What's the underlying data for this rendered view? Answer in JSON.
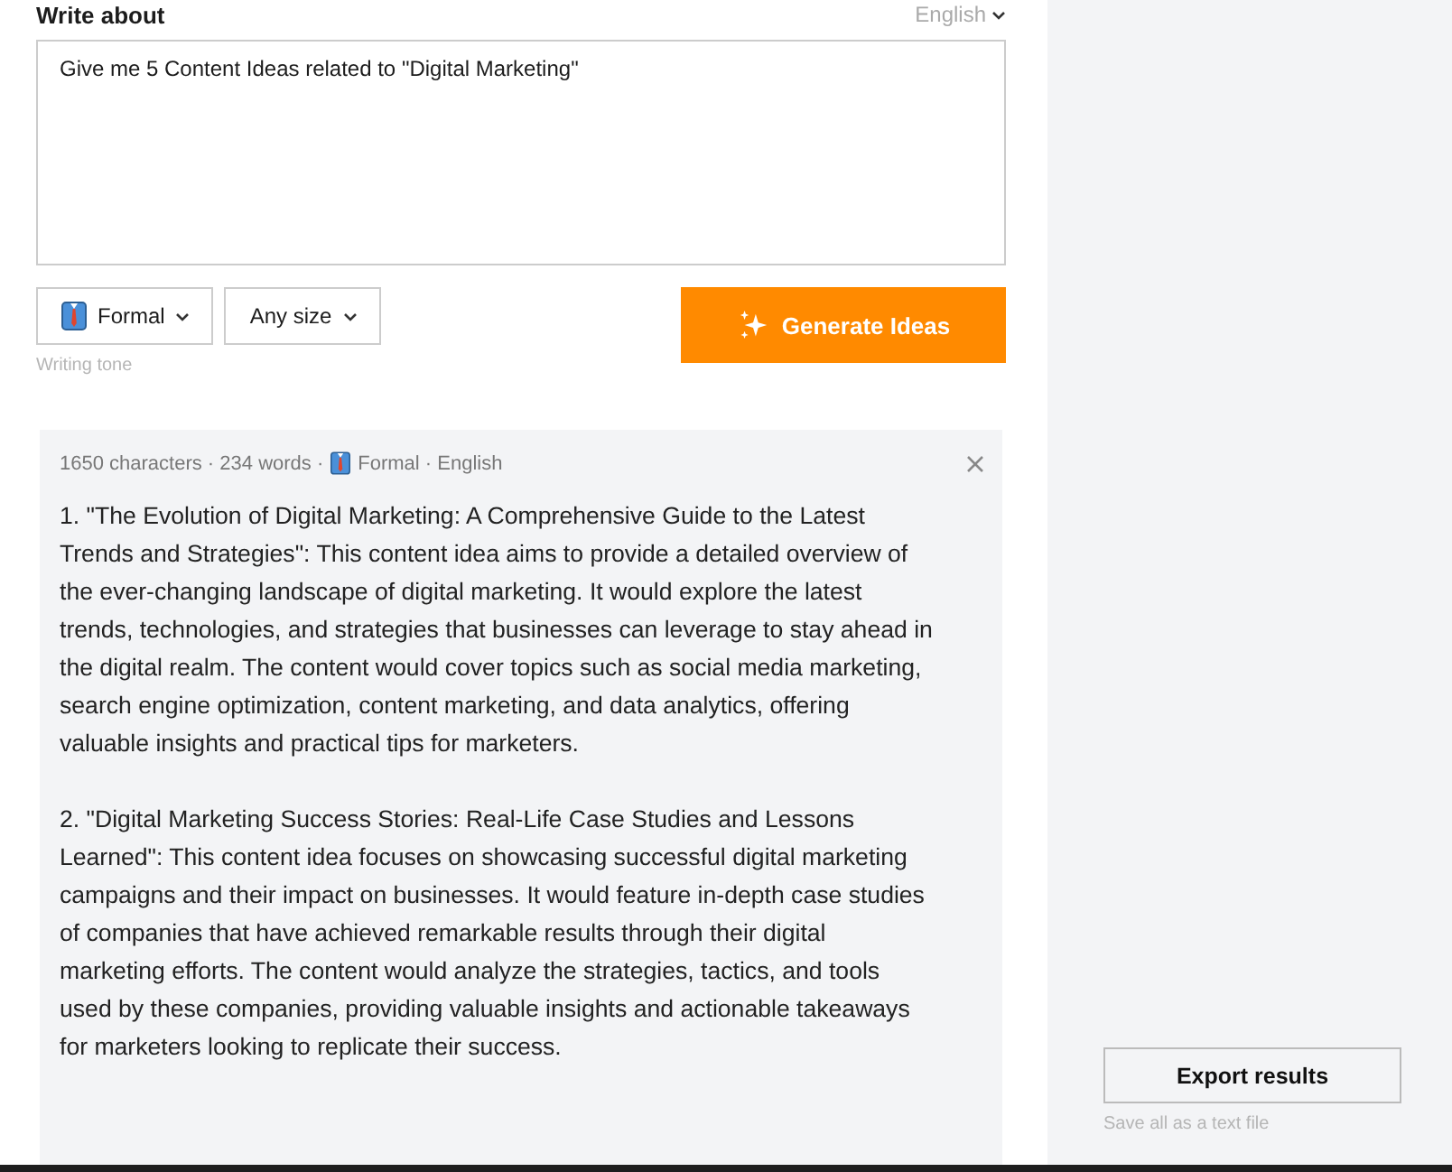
{
  "header": {
    "title": "Write about",
    "language": "English"
  },
  "prompt": {
    "value": "Give me 5 Content Ideas related to \"Digital Marketing\""
  },
  "options": [
    {
      "kind": "tone",
      "label": "Formal"
    },
    {
      "kind": "size",
      "label": "Any size"
    }
  ],
  "tone_hint": "Writing tone",
  "generate_button": "Generate Ideas",
  "result": {
    "meta_stats": "1650 characters · 234 words ·",
    "meta_settings": "Formal · English",
    "paragraphs": [
      "1. \"The Evolution of Digital Marketing: A Comprehensive Guide to the Latest Trends and Strategies\": This content idea aims to provide a detailed overview of the ever-changing landscape of digital marketing. It would explore the latest trends, technologies, and strategies that businesses can leverage to stay ahead in the digital realm. The content would cover topics such as social media marketing, search engine optimization, content marketing, and data analytics, offering valuable insights and practical tips for marketers.",
      "2. \"Digital Marketing Success Stories: Real-Life Case Studies and Lessons Learned\": This content idea focuses on showcasing successful digital marketing campaigns and their impact on businesses. It would feature in-depth case studies of companies that have achieved remarkable results through their digital marketing efforts. The content would analyze the strategies, tactics, and tools used by these companies, providing valuable insights and actionable takeaways for marketers looking to replicate their success."
    ]
  },
  "export": {
    "button": "Export results",
    "hint": "Save all as a text file"
  }
}
